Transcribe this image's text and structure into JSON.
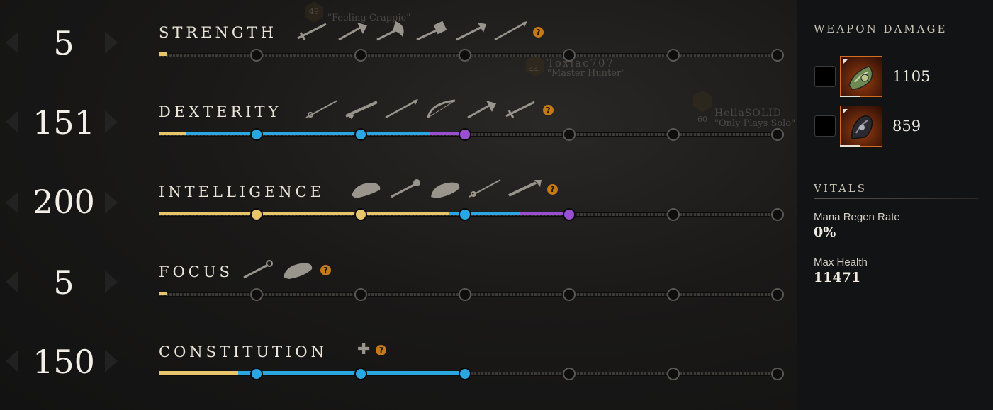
{
  "attributes": [
    {
      "name": "STRENGTH",
      "value": "5",
      "weapons": [
        "sword-icon",
        "hatchet-icon",
        "great-axe-icon",
        "war-hammer-icon",
        "throwing-axe-icon",
        "spear-icon"
      ],
      "has_plus": false,
      "progress_fraction": 0.013
    },
    {
      "name": "DEXTERITY",
      "value": "151",
      "weapons": [
        "rapier-icon",
        "musket-icon",
        "spear-icon",
        "bow-icon",
        "hatchet-icon",
        "sword-icon"
      ],
      "has_plus": false,
      "progress_fraction": 0.5
    },
    {
      "name": "INTELLIGENCE",
      "value": "200",
      "weapons": [
        "ice-gauntlet-icon",
        "fire-staff-icon",
        "void-gauntlet-icon",
        "rapier-icon",
        "blunderbuss-icon"
      ],
      "has_plus": false,
      "progress_fraction": 0.667
    },
    {
      "name": "FOCUS",
      "value": "5",
      "weapons": [
        "life-staff-icon",
        "void-gauntlet-icon"
      ],
      "has_plus": false,
      "progress_fraction": 0.013
    },
    {
      "name": "CONSTITUTION",
      "value": "150",
      "weapons": [],
      "has_plus": true,
      "progress_fraction": 0.5
    }
  ],
  "colors": {
    "gold": "#e8c56a",
    "blue": "#2aa6e0",
    "purple": "#9a4fd0",
    "help": "#c57a16",
    "panel_accent": "#d36d1f"
  },
  "weapon_damage": {
    "title": "WEAPON DAMAGE",
    "items": [
      {
        "value": "1105",
        "icon": "ice-gauntlet-weapon-icon",
        "checked": false
      },
      {
        "value": "859",
        "icon": "void-gauntlet-weapon-icon",
        "checked": false
      }
    ]
  },
  "vitals": {
    "title": "VITALS",
    "items": [
      {
        "label": "Mana Regen Rate",
        "value": "0%"
      },
      {
        "label": "Max Health",
        "value": "11471"
      }
    ]
  },
  "background_players": [
    {
      "level": "49",
      "name": "\"Feeling Crappie\""
    },
    {
      "level": "44",
      "name": "Toxiac707",
      "title": "\"Master Hunter\""
    },
    {
      "level": "60",
      "name": "HellaSOLID",
      "title": "\"Only Plays Solo\""
    }
  ]
}
